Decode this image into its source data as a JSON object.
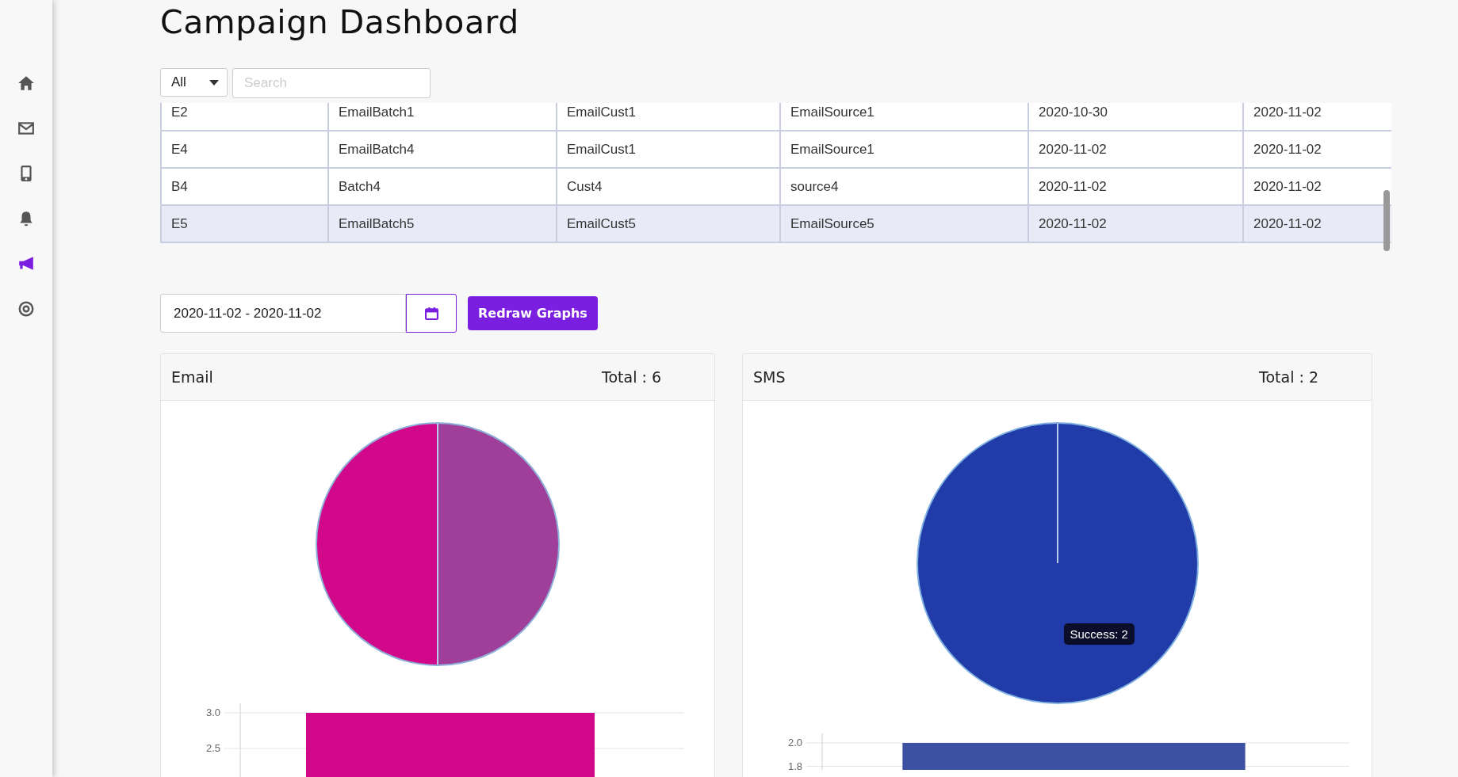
{
  "sidebar": {
    "items": [
      {
        "selected": false
      },
      {
        "selected": false
      },
      {
        "selected": false
      },
      {
        "selected": false
      },
      {
        "selected": true
      },
      {
        "selected": false
      }
    ]
  },
  "title": "Campaign Dashboard",
  "filter": {
    "value": "All"
  },
  "search": {
    "placeholder": "Search"
  },
  "table": {
    "rows": [
      {
        "selected": false,
        "cells": [
          "E2",
          "EmailBatch1",
          "EmailCust1",
          "EmailSource1",
          "2020-10-30",
          "2020-11-02"
        ]
      },
      {
        "selected": false,
        "cells": [
          "E4",
          "EmailBatch4",
          "EmailCust1",
          "EmailSource1",
          "2020-11-02",
          "2020-11-02"
        ]
      },
      {
        "selected": false,
        "cells": [
          "B4",
          "Batch4",
          "Cust4",
          "source4",
          "2020-11-02",
          "2020-11-02"
        ]
      },
      {
        "selected": true,
        "cells": [
          "E5",
          "EmailBatch5",
          "EmailCust5",
          "EmailSource5",
          "2020-11-02",
          "2020-11-02"
        ]
      }
    ]
  },
  "date_range": {
    "value": "2020-11-02 - 2020-11-02"
  },
  "redraw_button": "Redraw Graphs",
  "cards": [
    {
      "title": "Email",
      "total": "Total : 6",
      "chart_data": {
        "type": "bar",
        "ylim": [
          2.09,
          3.0
        ],
        "yticks": [
          {
            "value": 2.5,
            "label": "2.5"
          },
          {
            "value": 3.0,
            "label": "3.0"
          }
        ],
        "series": [
          {
            "color": "#d1088a",
            "values": [
              3
            ]
          }
        ]
      }
    },
    {
      "title": "SMS",
      "total": "Total : 2",
      "tooltip": "Success: 2",
      "chart_data": {
        "type": "bar",
        "ylim": [
          1.77,
          2.0
        ],
        "yticks": [
          {
            "value": 1.8,
            "label": "1.8"
          },
          {
            "value": 2.0,
            "label": "2.0"
          }
        ],
        "series": [
          {
            "color": "#3d51a3",
            "values": [
              2
            ]
          }
        ]
      }
    }
  ]
}
